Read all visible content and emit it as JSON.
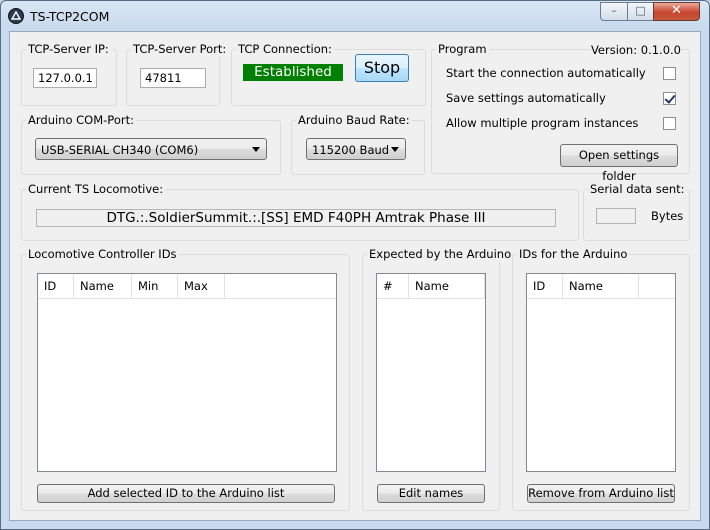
{
  "window": {
    "title": "TS-TCP2COM",
    "min_glyph": "–",
    "max_glyph": "□",
    "close_glyph": "✕"
  },
  "tcp": {
    "server_ip_label": "TCP-Server IP:",
    "server_ip_value": "127.0.0.1",
    "server_port_label": "TCP-Server Port:",
    "server_port_value": "47811",
    "connection_label": "TCP Connection:",
    "status_text": "Established",
    "status_color": "#008000",
    "stop_label": "Stop"
  },
  "program": {
    "group_label": "Program",
    "version_text": "Version: 0.1.0.0",
    "options": [
      {
        "label": "Start the connection automatically",
        "checked": false
      },
      {
        "label": "Save settings automatically",
        "checked": true
      },
      {
        "label": "Allow multiple program instances",
        "checked": false
      }
    ],
    "open_folder_label": "Open settings folder"
  },
  "arduino": {
    "com_port_label": "Arduino COM-Port:",
    "com_port_value": "USB-SERIAL CH340 (COM6)",
    "baud_label": "Arduino Baud Rate:",
    "baud_value": "115200 Baud"
  },
  "locomotive": {
    "label": "Current TS Locomotive:",
    "value": "DTG.:.SoldierSummit.:.[SS] EMD F40PH Amtrak Phase III"
  },
  "serial": {
    "label": "Serial data sent:",
    "value": "",
    "unit": "Bytes"
  },
  "controller_ids": {
    "label": "Locomotive Controller IDs",
    "columns": [
      "ID",
      "Name",
      "Min",
      "Max"
    ],
    "button_label": "Add selected ID to the Arduino list"
  },
  "expected": {
    "label": "Expected by the Arduino",
    "columns": [
      "#",
      "Name"
    ],
    "button_label": "Edit names"
  },
  "arduino_ids": {
    "label": "IDs for the Arduino",
    "columns": [
      "ID",
      "Name"
    ],
    "button_label": "Remove from Arduino list"
  },
  "colors": {
    "accent_blue": "#3c7fb1",
    "status_green": "#008000",
    "close_red": "#c9452d"
  }
}
